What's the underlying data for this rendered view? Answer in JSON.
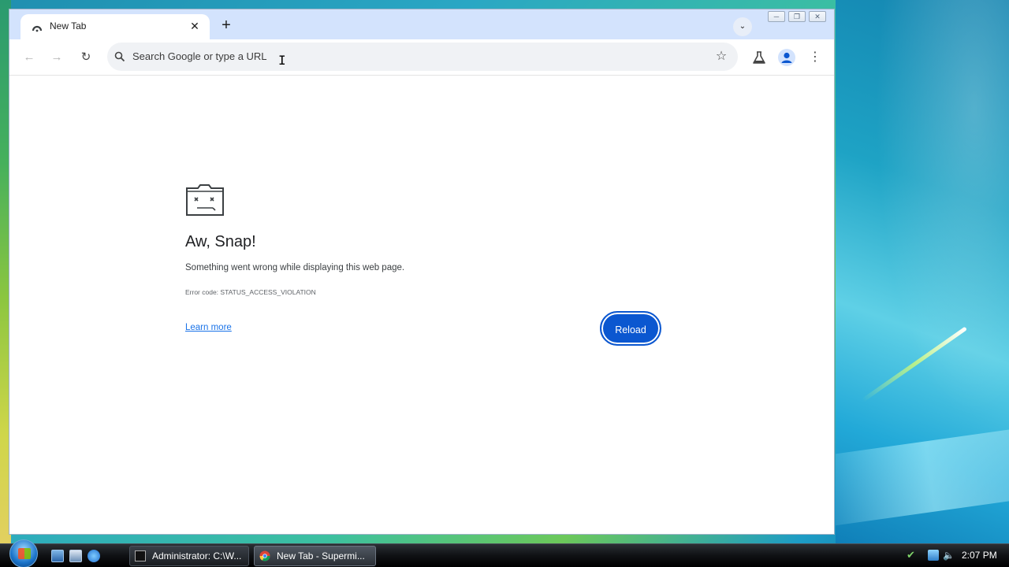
{
  "browser": {
    "tab": {
      "title": "New Tab",
      "close_glyph": "✕"
    },
    "new_tab_glyph": "+",
    "tab_search_glyph": "⌄",
    "window_controls": {
      "minimize": "─",
      "restore": "❐",
      "close": "✕"
    },
    "toolbar": {
      "back_glyph": "←",
      "forward_glyph": "→",
      "reload_glyph": "↻",
      "omnibox_placeholder": "Search Google or type a URL",
      "star_glyph": "☆",
      "menu_glyph": "⋮"
    }
  },
  "error_page": {
    "title": "Aw, Snap!",
    "message": "Something went wrong while displaying this web page.",
    "error_code": "Error code: STATUS_ACCESS_VIOLATION",
    "learn_more": "Learn more",
    "reload_label": "Reload"
  },
  "taskbar": {
    "tasks": [
      {
        "label": "Administrator: C:\\W...",
        "icon": "cmd-icon"
      },
      {
        "label": "New Tab - Supermi...",
        "icon": "chrome-icon"
      }
    ],
    "clock": "2:07 PM"
  },
  "colors": {
    "accent": "#0b57d0",
    "link": "#1a73e8",
    "tabstrip": "#d3e3fd"
  }
}
